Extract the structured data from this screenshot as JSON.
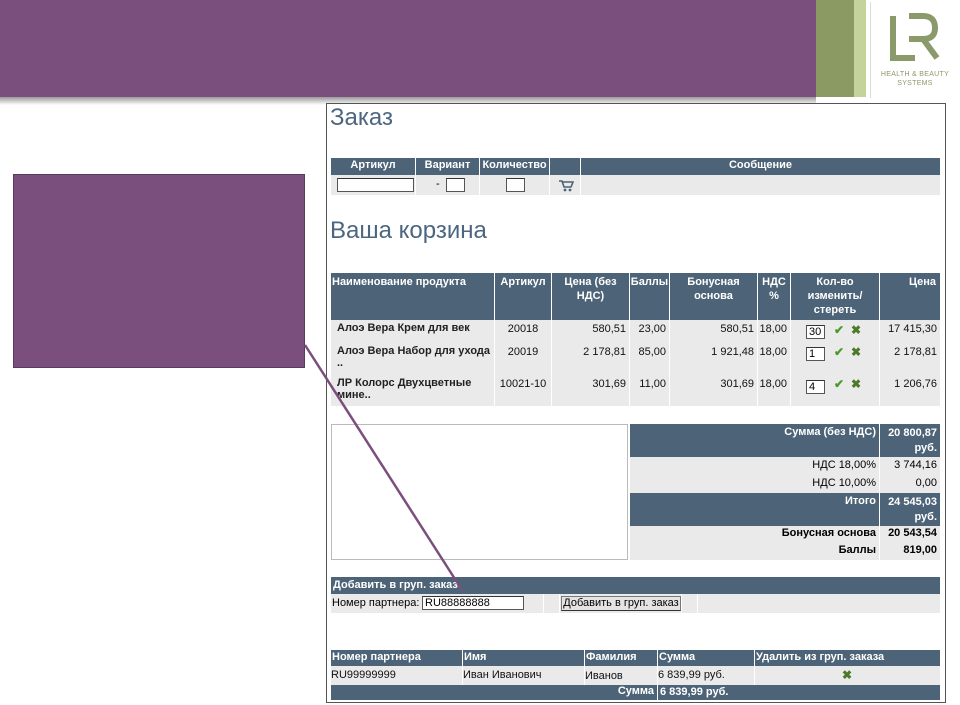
{
  "logo": {
    "tagline_1": "HEALTH & BEAUTY",
    "tagline_2": "SYSTEMS",
    "letters": "LR"
  },
  "order": {
    "title": "Заказ",
    "headers": {
      "article": "Артикул",
      "variant": "Вариант",
      "quantity": "Количество",
      "message": "Сообщение"
    },
    "variant_dash": "-",
    "cart_icon": "cart-icon"
  },
  "cart": {
    "title": "Ваша корзина",
    "headers": {
      "name": "Наименование продукта",
      "article": "Артикул",
      "price": "Цена (без НДС)",
      "points": "Баллы",
      "bonus": "Бонусная основа",
      "vat": "НДС %",
      "qty": "Кол-во изменить/ стереть",
      "total": "Цена"
    },
    "rows": [
      {
        "name": "Алоэ Вера Крем для век",
        "name2": "",
        "article": "20018",
        "price": "580,51",
        "points": "23,00",
        "bonus": "580,51",
        "vat": "18,00",
        "qty": "30",
        "total": "17 415,30"
      },
      {
        "name": "Алоэ Вера Набор для ухода",
        "name2": "..",
        "article": "20019",
        "price": "2 178,81",
        "points": "85,00",
        "bonus": "1 921,48",
        "vat": "18,00",
        "qty": "1",
        "total": "2 178,81"
      },
      {
        "name": "ЛР Колорс Двухцветные",
        "name2": "мине..",
        "article": "10021-10",
        "price": "301,69",
        "points": "11,00",
        "bonus": "301,69",
        "vat": "18,00",
        "qty": "4",
        "total": "1 206,76"
      }
    ]
  },
  "summary": {
    "sum_label": "Сумма (без НДС)",
    "sum_value_1": "20 800,87",
    "sum_value_2": "руб.",
    "vat18_label": "НДС 18,00%",
    "vat18_value": "3 744,16",
    "vat10_label": "НДС 10,00%",
    "vat10_value": "0,00",
    "total_label": "Итого",
    "total_value_1": "24 545,03",
    "total_value_2": "руб.",
    "bonus_label": "Бонусная основа",
    "bonus_value": "20 543,54",
    "points_label": "Баллы",
    "points_value": "819,00"
  },
  "group": {
    "title": "Добавить в груп. заказ",
    "partner_label": "Номер партнера:",
    "partner_value": "RU88888888",
    "add_button": "Добавить в груп. заказ"
  },
  "group_table": {
    "headers": {
      "partner": "Номер партнера",
      "name": "Имя",
      "surname": "Фамилия",
      "sum": "Сумма",
      "remove": "Удалить из груп. заказа"
    },
    "rows": [
      {
        "partner": "RU99999999",
        "name": "Иван Иванович",
        "surname": "Иванов",
        "sum": "6 839,99 руб."
      }
    ],
    "total_label": "Сумма",
    "total_value": "6 839,99 руб."
  },
  "colors": {
    "header": "#4d6377",
    "purple": "#7b4f7d",
    "cell": "#eaeaea"
  }
}
